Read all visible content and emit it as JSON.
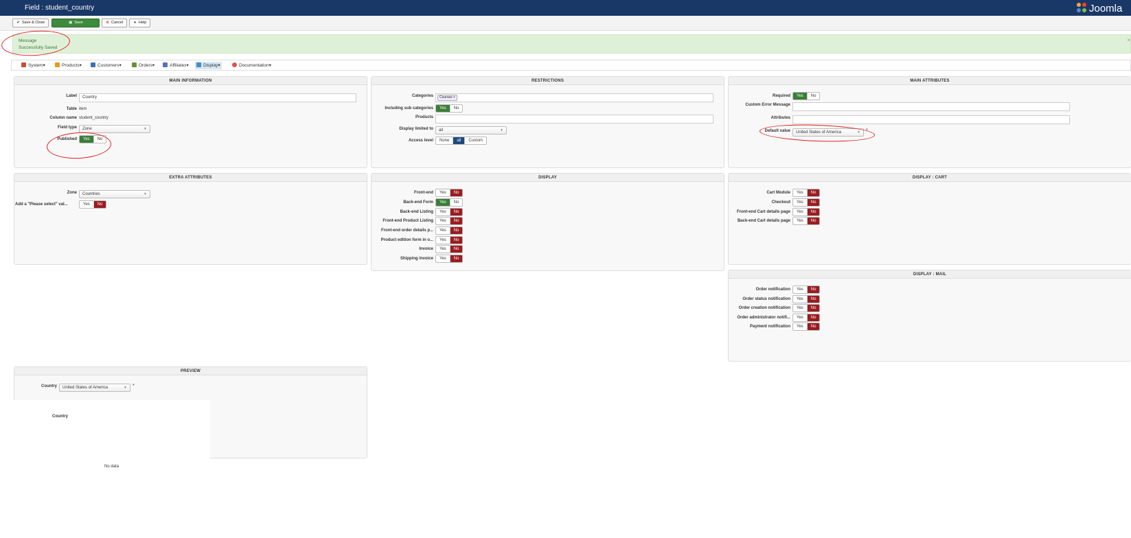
{
  "header": {
    "title": "Field : student_country",
    "logo_text": "Joomla"
  },
  "toolbar": {
    "save_close": "Save & Close",
    "save": "Save",
    "cancel": "Cancel",
    "help": "Help"
  },
  "message": {
    "heading": "Message",
    "text": "Successfully Saved",
    "close": "×"
  },
  "menu": {
    "items": [
      {
        "label": "System",
        "icon": "wrench-icon",
        "color": "#c8502b"
      },
      {
        "label": "Products",
        "icon": "box-icon",
        "color": "#e89a1c"
      },
      {
        "label": "Customers",
        "icon": "users-icon",
        "color": "#3d6fb5"
      },
      {
        "label": "Orders",
        "icon": "cart-icon",
        "color": "#6a8f3a"
      },
      {
        "label": "Affiliates",
        "icon": "affiliate-icon",
        "color": "#5a6fb8"
      },
      {
        "label": "Display",
        "icon": "display-icon",
        "color": "#3f8fc7"
      },
      {
        "label": "Documentation",
        "icon": "lifebuoy-icon",
        "color": "#d9534f"
      }
    ],
    "dropdown_glyph": "▾"
  },
  "main_info": {
    "title": "MAIN INFORMATION",
    "label_label": "Label",
    "label_value": "Country",
    "table_label": "Table",
    "table_value": "item",
    "column_label": "Column name",
    "column_value": "student_country",
    "fieldtype_label": "Field type",
    "fieldtype_value": "Zone",
    "published_label": "Published",
    "yes": "Yes",
    "no": "No"
  },
  "restrictions": {
    "title": "RESTRICTIONS",
    "categories_label": "Categories",
    "category_tag": "Courses",
    "subcat_label": "Including sub categories",
    "products_label": "Products",
    "display_limited_label": "Display limited to",
    "display_limited_value": "all",
    "access_label": "Access level",
    "access_none": "None",
    "access_all": "all",
    "access_custom": "Custom",
    "yes": "Yes",
    "no": "No"
  },
  "main_attributes": {
    "title": "MAIN ATTRIBUTES",
    "required_label": "Required",
    "custom_error_label": "Custom Error Message",
    "attributes_label": "Attributes",
    "default_label": "Default value",
    "default_value": "United States of America",
    "required_star": "*",
    "yes": "Yes",
    "no": "No"
  },
  "extra_attributes": {
    "title": "EXTRA ATTRIBUTES",
    "zone_label": "Zone",
    "zone_value": "Countries",
    "please_select_label": "Add a \"Please select\" val...",
    "yes": "Yes",
    "no": "No"
  },
  "display": {
    "title": "DISPLAY",
    "rows": [
      {
        "label": "Front-end",
        "selected": "No"
      },
      {
        "label": "Back-end Form",
        "selected": "Yes"
      },
      {
        "label": "Back-end Listing",
        "selected": "No"
      },
      {
        "label": "Front-end Product Listing",
        "selected": "No"
      },
      {
        "label": "Front-end order details p...",
        "selected": "No"
      },
      {
        "label": "Product edition form in o...",
        "selected": "No"
      },
      {
        "label": "Invoice",
        "selected": "No"
      },
      {
        "label": "Shipping invoice",
        "selected": "No"
      }
    ],
    "yes": "Yes",
    "no": "No"
  },
  "display_cart": {
    "title": "DISPLAY : CART",
    "rows": [
      {
        "label": "Cart Module",
        "selected": "No"
      },
      {
        "label": "Checkout",
        "selected": "No"
      },
      {
        "label": "Front-end Cart details page",
        "selected": "No"
      },
      {
        "label": "Back-end Cart details page",
        "selected": "No"
      }
    ],
    "yes": "Yes",
    "no": "No"
  },
  "display_mail": {
    "title": "DISPLAY : MAIL",
    "rows": [
      {
        "label": "Order notification",
        "selected": "No"
      },
      {
        "label": "Order status notification",
        "selected": "No"
      },
      {
        "label": "Order creation notification",
        "selected": "No"
      },
      {
        "label": "Order administrator notifi...",
        "selected": "No"
      },
      {
        "label": "Payment notification",
        "selected": "No"
      }
    ],
    "yes": "Yes",
    "no": "No"
  },
  "preview": {
    "title": "PREVIEW",
    "country_label": "Country",
    "country_value": "United States of America",
    "required_star": "*",
    "table_heading": "Country",
    "no_data": "No data"
  },
  "colors": {
    "header_bg": "#1a3867",
    "yes_green": "#3a7e38",
    "no_red": "#9b1c20",
    "annotation_red": "#e02020"
  }
}
